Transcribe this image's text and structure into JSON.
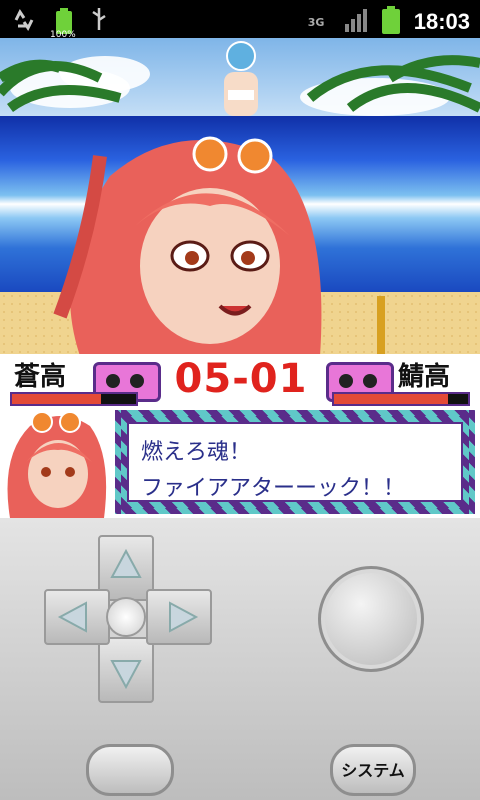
{
  "status_bar": {
    "battery_percent_label": "100%",
    "network_label": "3G",
    "time": "18:03"
  },
  "scoreboard": {
    "left_team": "蒼高",
    "right_team": "鯖高",
    "score": "05-01",
    "left_hp_fraction": 0.72,
    "right_hp_fraction": 0.85
  },
  "dialog": {
    "line1": "燃えろ魂！",
    "line2": "ファイアアターーック！！"
  },
  "controls": {
    "system_button_label": "システム",
    "icons": [
      "dpad-up-icon",
      "dpad-down-icon",
      "dpad-left-icon",
      "dpad-right-icon",
      "action-button-icon"
    ]
  },
  "colors": {
    "score_red": "#e0231d",
    "plate_pink": "#e876d8",
    "frame_purple": "#5a2c8a",
    "dialog_text": "#2a2f8a"
  }
}
